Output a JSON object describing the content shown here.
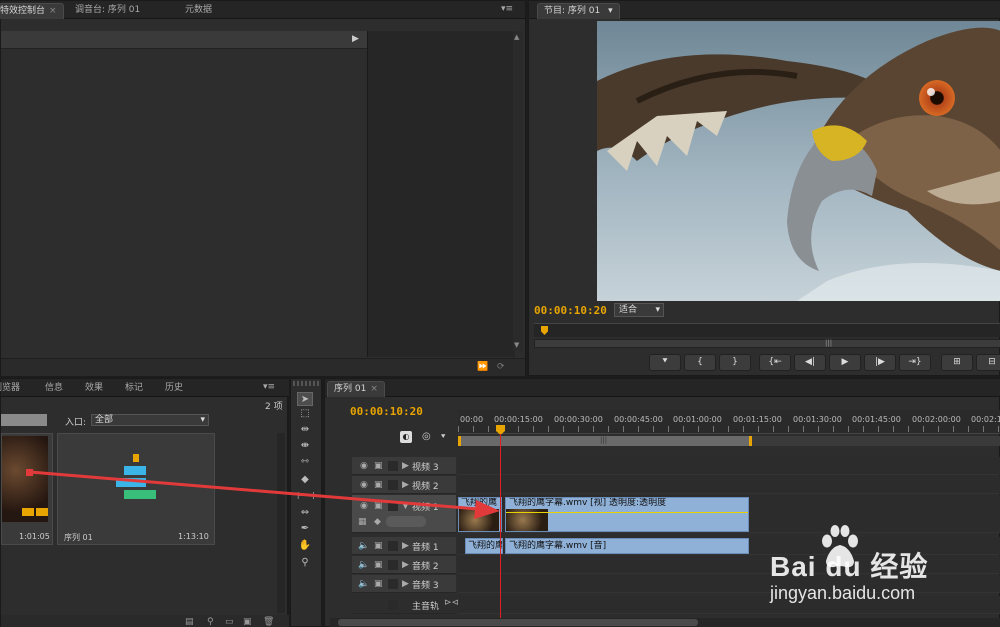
{
  "top_left_panel": {
    "tabs": [
      {
        "label": "特效控制台",
        "close": "×"
      },
      {
        "label": "调音台: 序列 01"
      },
      {
        "label": "元数据"
      }
    ]
  },
  "program_monitor": {
    "tab": "节目: 序列 01",
    "timecode": "00:00:10:20",
    "fit_label": "适合"
  },
  "project_panel": {
    "tabs": [
      {
        "label": "浏览器"
      },
      {
        "label": "信息"
      },
      {
        "label": "效果"
      },
      {
        "label": "标记"
      },
      {
        "label": "历史"
      }
    ],
    "item_count": "2 项",
    "entry_label": "入口:",
    "entry_value": "全部",
    "items": [
      {
        "duration": "1:01:05"
      },
      {
        "name": "序列 01",
        "duration": "1:13:10"
      }
    ]
  },
  "timeline": {
    "tab": "序列 01",
    "timecode": "00:00:10:20",
    "ruler": [
      "00:00",
      "00:00:15:00",
      "00:00:30:00",
      "00:00:45:00",
      "00:01:00:00",
      "00:01:15:00",
      "00:01:30:00",
      "00:01:45:00",
      "00:02:00:00",
      "00:02:1"
    ],
    "video_tracks": [
      {
        "label": "视频 3"
      },
      {
        "label": "视频 2"
      },
      {
        "label": "视频 1"
      }
    ],
    "audio_tracks": [
      {
        "label": "音频 1"
      },
      {
        "label": "音频 2"
      },
      {
        "label": "音频 3"
      }
    ],
    "master_track": "主音轨",
    "video_clip_label": "飞翔的鹰字幕.wmv [视] 透明度:透明度",
    "video_clip_label_left": "飞翔的鹰",
    "audio_clip_label": "飞翔的鹰字幕.wmv [音]",
    "audio_clip_label_left": "飞翔的鹰"
  },
  "watermark": {
    "brand": "Bai du 经验",
    "url": "jingyan.baidu.com"
  },
  "colors": {
    "timecode": "#e8a400",
    "clip_blue": "#8fb1d8",
    "playhead_red": "#e02020",
    "arrow_red": "#e23a3a"
  }
}
